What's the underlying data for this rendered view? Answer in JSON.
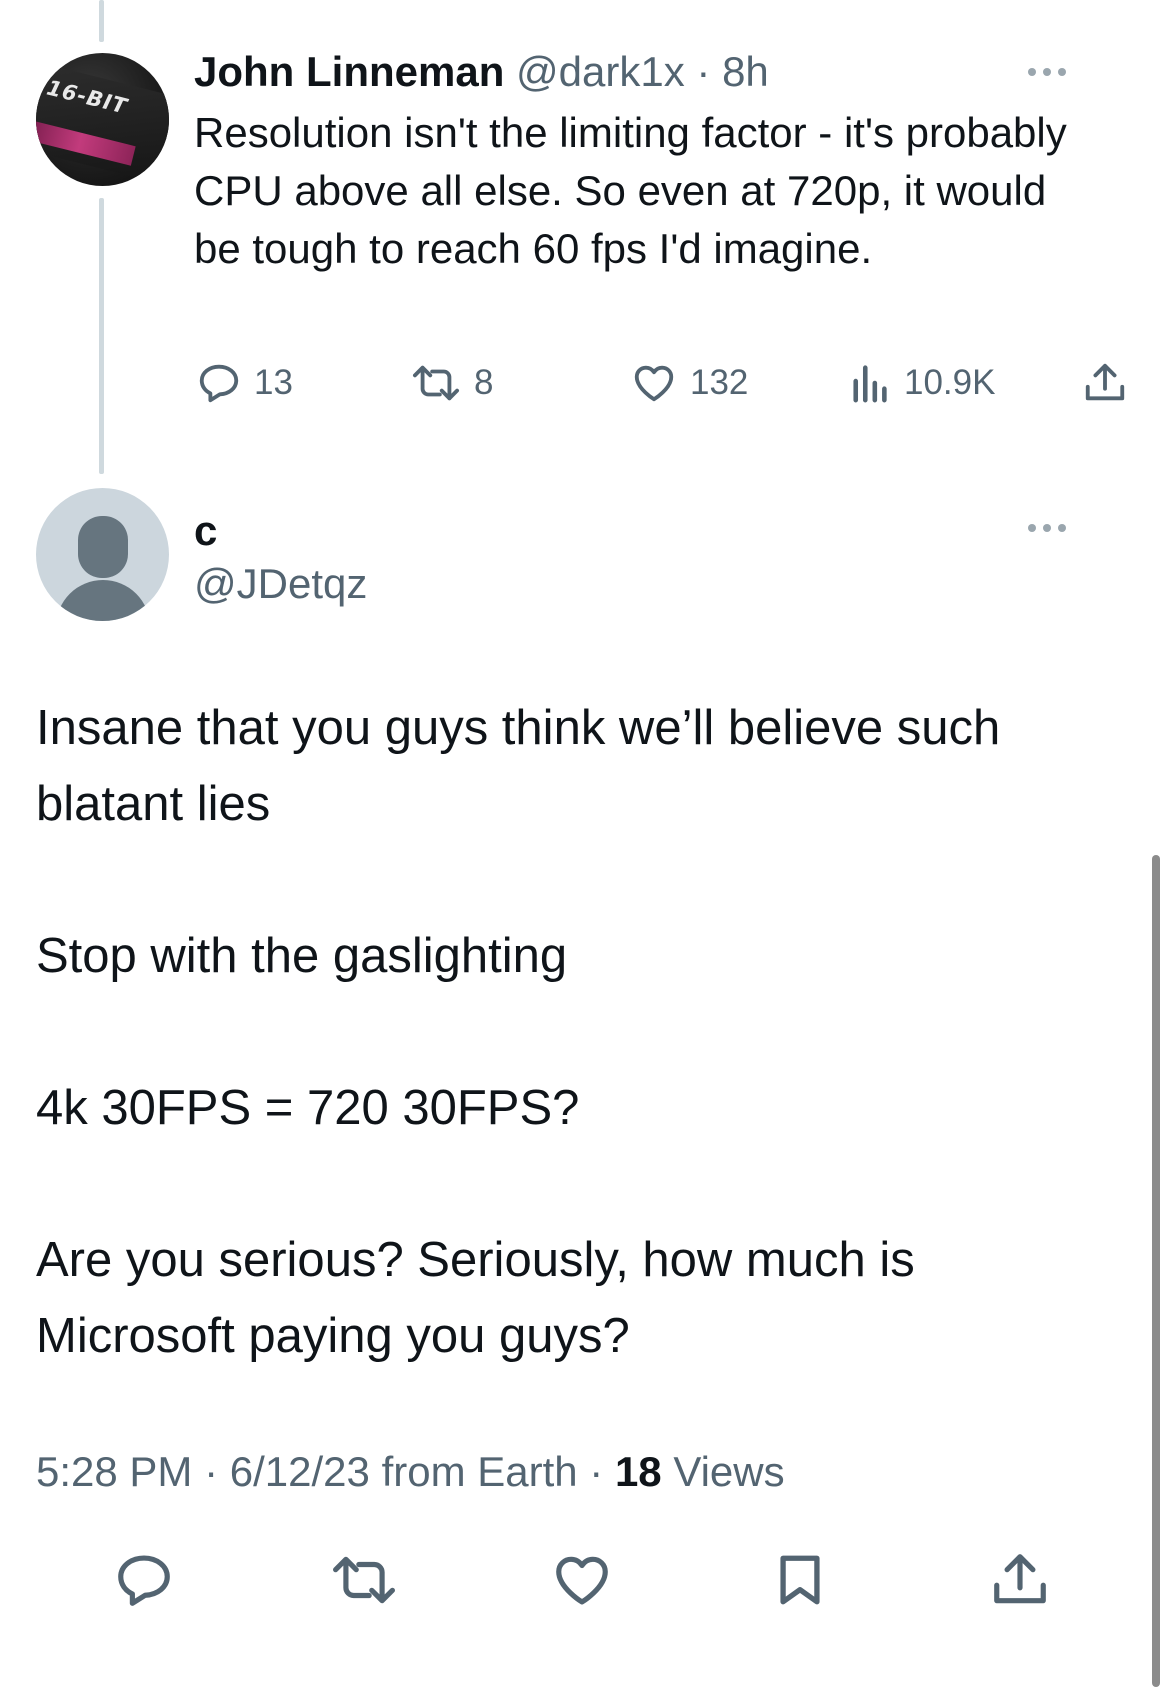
{
  "parent_tweet": {
    "avatar_label": "16-BIT",
    "name": "John Linneman",
    "handle": "@dark1x",
    "separator": " · ",
    "time": "8h",
    "text": "Resolution isn't the limiting factor - it's probably CPU above all else. So even at 720p, it would be tough to reach 60 fps I'd imagine.",
    "actions": {
      "replies": "13",
      "retweets": "8",
      "likes": "132",
      "views": "10.9K"
    }
  },
  "reply_tweet": {
    "name": "c",
    "handle": "@JDetqz",
    "paragraphs": [
      "Insane that you guys think we’ll believe such blatant lies",
      "Stop with the gaslighting",
      "4k 30FPS = 720 30FPS?",
      "Are you serious? Seriously, how much is Microsoft paying you guys?"
    ],
    "timestamp": {
      "time": "5:28 PM",
      "date": "6/12/23",
      "source": "from Earth",
      "views_count": "18",
      "views_label": "Views"
    }
  },
  "icons": {
    "reply": "speech-bubble-icon",
    "retweet": "retweet-icon",
    "like": "heart-icon",
    "views": "bar-chart-icon",
    "bookmark": "bookmark-icon",
    "share": "share-icon",
    "more": "more-dots-icon"
  },
  "colors": {
    "text_primary": "#0f1419",
    "text_secondary": "#536471",
    "thread_line": "#cfd9de"
  }
}
